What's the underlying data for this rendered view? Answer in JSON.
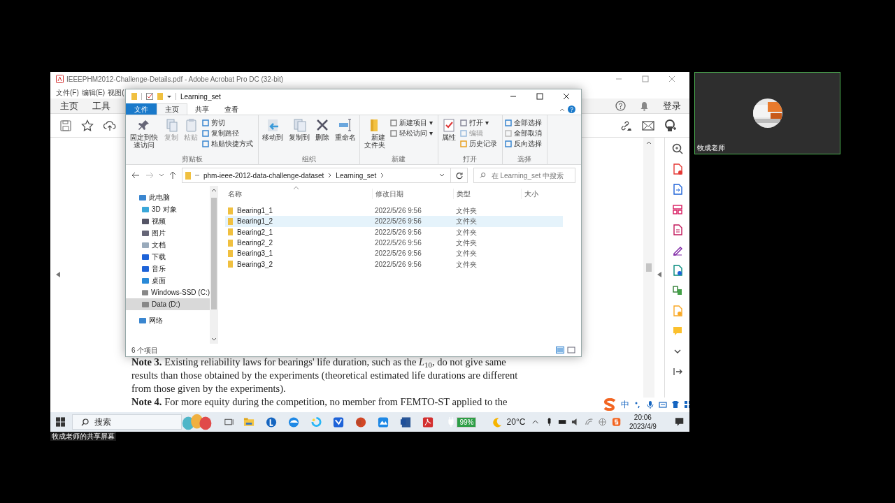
{
  "meeting": {
    "presenter_label": "牧成老师",
    "share_label": "牧成老师的共享屏幕"
  },
  "acrobat": {
    "title": "IEEEPHM2012-Challenge-Details.pdf - Adobe Acrobat Pro DC (32-bit)",
    "menu": [
      "文件(F)",
      "编辑(E)",
      "视图("
    ],
    "tabs": [
      {
        "label": "主页",
        "selected": false
      },
      {
        "label": "工具",
        "selected": false
      }
    ],
    "login": "登录",
    "page_paragraphs": [
      {
        "lines": [
          "**Note 3.**  Existing reliability laws for bearings' life duration, such as the *L*$_{10}$, do not give same",
          "results than those obtained by the experiments (theoretical estimated life durations are different",
          "from those given by the experiments)."
        ]
      },
      {
        "lines": [
          "**Note 4.**   For more equity during the competition, no member from FEMTO-ST applied to the"
        ]
      }
    ]
  },
  "explorer": {
    "title": "Learning_set",
    "ribbon_tabs": [
      {
        "label": "文件",
        "kind": "file",
        "selected": false
      },
      {
        "label": "主页",
        "kind": "tab",
        "selected": true
      },
      {
        "label": "共享",
        "kind": "tab",
        "selected": false
      },
      {
        "label": "查看",
        "kind": "tab",
        "selected": false
      }
    ],
    "groups": [
      {
        "label": "剪贴板",
        "items": [
          {
            "kind": "large",
            "label": "固定到快速访问",
            "disabled": false
          },
          {
            "kind": "large",
            "label": "复制",
            "disabled": true
          },
          {
            "kind": "large",
            "label": "粘贴",
            "disabled": true
          },
          {
            "kind": "small",
            "items": [
              {
                "label": "剪切",
                "disabled": false
              },
              {
                "label": "复制路径",
                "disabled": false
              },
              {
                "label": "粘贴快捷方式",
                "disabled": false
              }
            ]
          }
        ]
      },
      {
        "label": "组织",
        "items": [
          {
            "kind": "large",
            "label": "移动到",
            "disabled": false
          },
          {
            "kind": "large",
            "label": "复制到",
            "disabled": false
          },
          {
            "kind": "large",
            "label": "删除",
            "disabled": false
          },
          {
            "kind": "large",
            "label": "重命名",
            "disabled": false
          }
        ]
      },
      {
        "label": "新建",
        "items": [
          {
            "kind": "large",
            "label": "新建文件夹",
            "disabled": false
          },
          {
            "kind": "small",
            "items": [
              {
                "label": "新建项目 ▾",
                "disabled": false
              },
              {
                "label": "轻松访问 ▾",
                "disabled": false
              }
            ]
          }
        ]
      },
      {
        "label": "打开",
        "items": [
          {
            "kind": "large",
            "label": "属性",
            "disabled": false
          },
          {
            "kind": "small",
            "items": [
              {
                "label": "打开 ▾",
                "disabled": false
              },
              {
                "label": "编辑",
                "disabled": true
              },
              {
                "label": "历史记录",
                "disabled": false
              }
            ]
          }
        ]
      },
      {
        "label": "选择",
        "items": [
          {
            "kind": "small",
            "items": [
              {
                "label": "全部选择",
                "disabled": false
              },
              {
                "label": "全部取消",
                "disabled": false
              },
              {
                "label": "反向选择",
                "disabled": false
              }
            ]
          }
        ]
      }
    ],
    "breadcrumbs": [
      "phm-ieee-2012-data-challenge-dataset",
      "Learning_set"
    ],
    "search": {
      "placeholder": "在 Learning_set 中搜索"
    },
    "nav": [
      {
        "label": "此电脑",
        "selected": false,
        "children": [
          {
            "label": "3D 对象",
            "selected": false
          },
          {
            "label": "视频",
            "selected": false
          },
          {
            "label": "图片",
            "selected": false
          },
          {
            "label": "文档",
            "selected": false
          },
          {
            "label": "下载",
            "selected": false
          },
          {
            "label": "音乐",
            "selected": false
          },
          {
            "label": "桌面",
            "selected": false
          },
          {
            "label": "Windows-SSD (C:)",
            "selected": false
          },
          {
            "label": "Data (D:)",
            "selected": true
          }
        ]
      },
      {
        "label": "网络",
        "selected": false
      }
    ],
    "columns": [
      "名称",
      "修改日期",
      "类型",
      "大小"
    ],
    "rows": [
      {
        "name": "Bearing1_1",
        "date": "2022/5/26 9:56",
        "type": "文件夹",
        "selected": false
      },
      {
        "name": "Bearing1_2",
        "date": "2022/5/26 9:56",
        "type": "文件夹",
        "selected": true
      },
      {
        "name": "Bearing2_1",
        "date": "2022/5/26 9:56",
        "type": "文件夹",
        "selected": false
      },
      {
        "name": "Bearing2_2",
        "date": "2022/5/26 9:56",
        "type": "文件夹",
        "selected": false
      },
      {
        "name": "Bearing3_1",
        "date": "2022/5/26 9:56",
        "type": "文件夹",
        "selected": false
      },
      {
        "name": "Bearing3_2",
        "date": "2022/5/26 9:56",
        "type": "文件夹",
        "selected": false
      }
    ],
    "status": "6 个项目"
  },
  "ime": {
    "mode": "中"
  },
  "taskbar": {
    "search": "搜索",
    "battery": "99%",
    "weather": "20°C",
    "time": "20:06",
    "date": "2023/4/9"
  }
}
